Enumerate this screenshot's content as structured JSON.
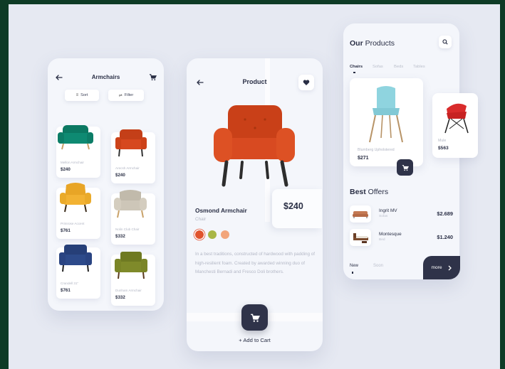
{
  "catalog": {
    "title": "Armchairs",
    "sort_label": "Sort",
    "filter_label": "Filter",
    "items": [
      {
        "name": "Mellon Armchair",
        "price": "$240",
        "color": "#0e8a72"
      },
      {
        "name": "Arecsh Armchair",
        "price": "$240",
        "color": "#d6481f"
      },
      {
        "name": "Primrose Accent",
        "price": "$761",
        "color": "#f2b233"
      },
      {
        "name": "Nolin Club Chair",
        "price": "$332",
        "color": "#cdc6b8"
      },
      {
        "name": "Crandell 31\"",
        "price": "$761",
        "color": "#2d4a8a"
      },
      {
        "name": "Dunham Armchair",
        "price": "$332",
        "color": "#7f8a2a"
      }
    ]
  },
  "product": {
    "title": "Product",
    "name": "Osmond Armchair",
    "category": "Chair",
    "price": "$240",
    "swatches": [
      "#e0532d",
      "#a8b646",
      "#f2a57b"
    ],
    "description": "In a best traditions, constructed of hardwood with padding of high-resilient foam. Created by awarded winning duo of Manchesti Bernadi and Fresco Doli brothers.",
    "add_to_cart": "+ Add to Cart",
    "chair_color": "#d84a21"
  },
  "products": {
    "title_bold": "Our",
    "title_rest": " Products",
    "tabs": [
      "Chairs",
      "Sofas",
      "Beds",
      "Tables"
    ],
    "featured": {
      "name": "Blumberg Upholstered",
      "price": "$271",
      "color": "#8fd4df"
    },
    "side": {
      "name": "Mule",
      "price": "$563",
      "color": "#d92b2b"
    },
    "best_bold": "Best",
    "best_rest": " Offers",
    "offers": [
      {
        "name": "Ingrit MV",
        "category": "Sofas",
        "price": "$2.689"
      },
      {
        "name": "Montesque",
        "category": "Bed",
        "price": "$1.240"
      }
    ],
    "bottom_tabs": [
      "New",
      "Soon"
    ],
    "more_label": "more"
  }
}
